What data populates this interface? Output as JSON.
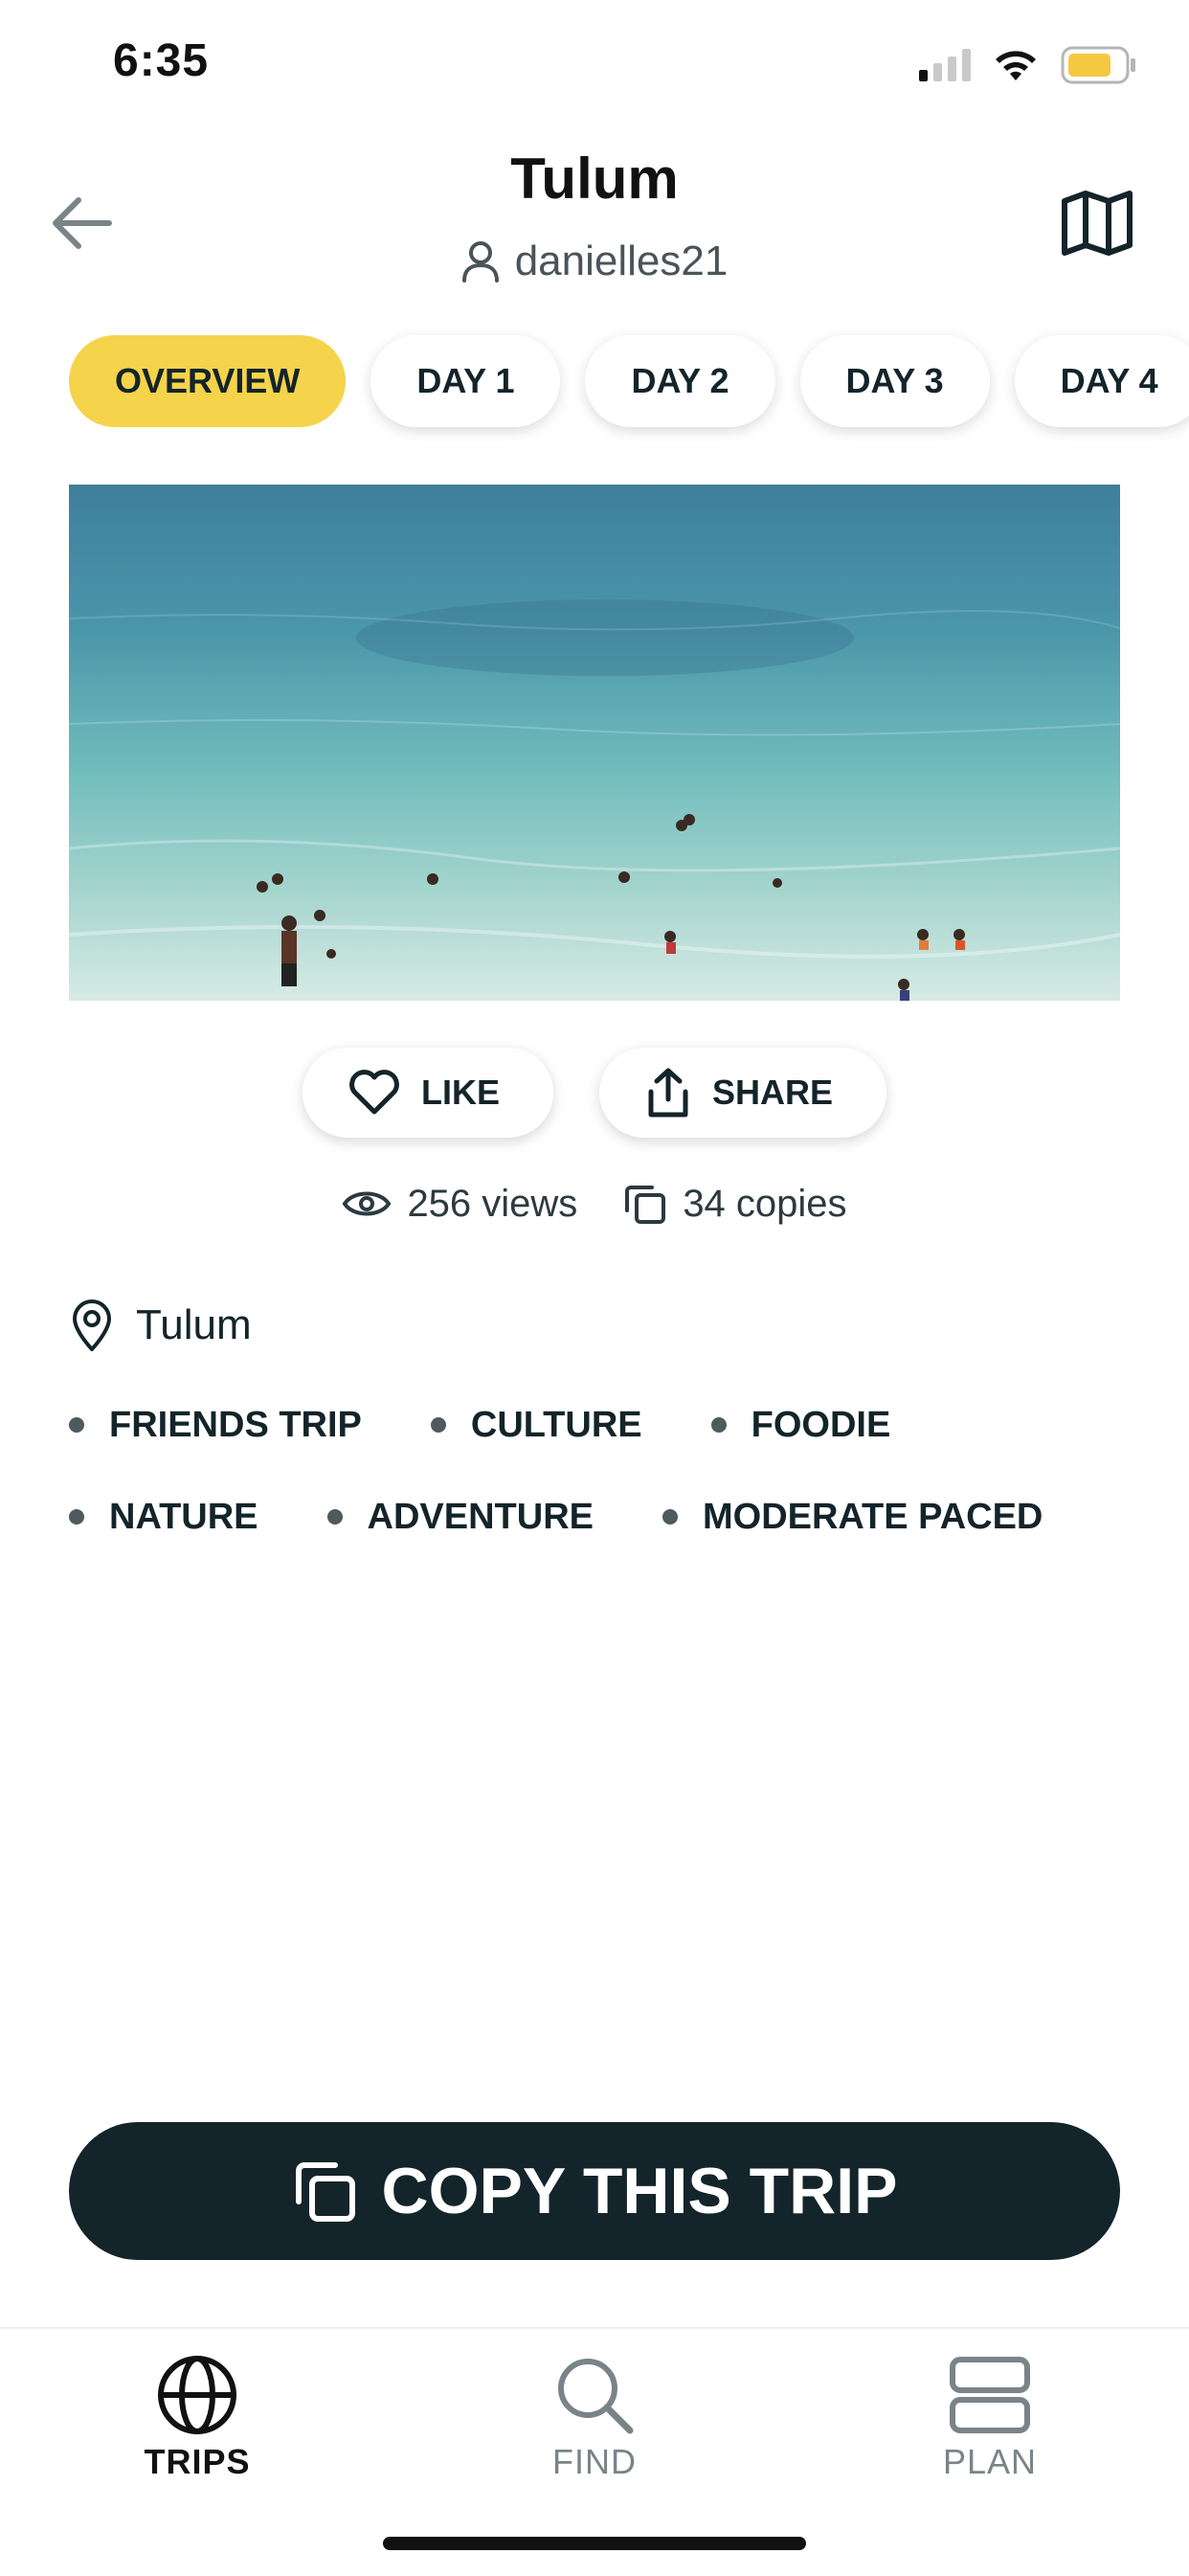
{
  "status_bar": {
    "time": "6:35"
  },
  "header": {
    "title": "Tulum",
    "author": "danielles21"
  },
  "tabs": [
    {
      "label": "OVERVIEW",
      "active": true
    },
    {
      "label": "DAY 1"
    },
    {
      "label": "DAY 2"
    },
    {
      "label": "DAY 3"
    },
    {
      "label": "DAY 4"
    }
  ],
  "actions": {
    "like_label": "LIKE",
    "share_label": "SHARE"
  },
  "stats": {
    "views": "256 views",
    "copies": "34 copies"
  },
  "location": "Tulum",
  "tags": {
    "row1": [
      "FRIENDS TRIP",
      "CULTURE",
      "FOODIE"
    ],
    "row2": [
      "NATURE",
      "ADVENTURE",
      "MODERATE PACED"
    ]
  },
  "copy_button": {
    "label": "COPY THIS TRIP"
  },
  "bottom_nav": {
    "trips": "TRIPS",
    "find": "FIND",
    "plan": "PLAN"
  },
  "colors": {
    "accent": "#f5d34b",
    "dark": "#13242a",
    "muted": "#7a8488",
    "battery": "#f5c842"
  }
}
